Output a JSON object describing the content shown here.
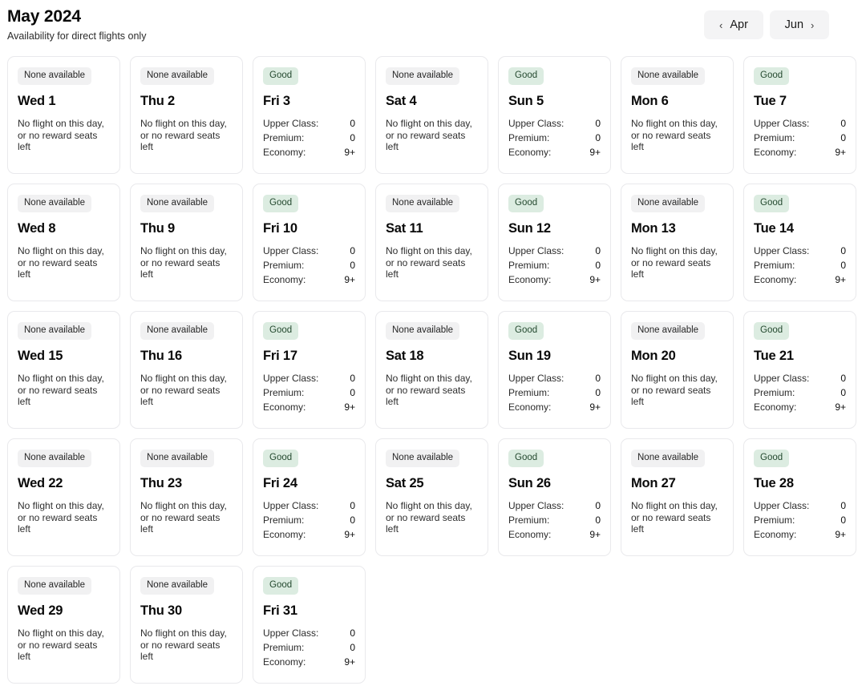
{
  "header": {
    "title": "May 2024",
    "subtitle": "Availability for direct flights only",
    "prev_label": "Apr",
    "next_label": "Jun",
    "prev_chevron": "‹",
    "next_chevron": "›"
  },
  "labels": {
    "badge_none": "None available",
    "badge_good": "Good",
    "empty_message": "No flight on this day, or no reward seats left",
    "upper_class": "Upper Class:",
    "premium": "Premium:",
    "economy": "Economy:"
  },
  "colors": {
    "good_badge_bg": "#dcece1",
    "good_badge_text": "#24492f",
    "none_badge_bg": "#f1f1f2",
    "none_badge_text": "#262626",
    "card_border": "#e9e9ec",
    "nav_button_bg": "#f4f4f5",
    "page_bg": "#ffffff"
  },
  "days": [
    {
      "day_label": "Wed 1",
      "status": "none",
      "badge": "None available",
      "message": "No flight on this day, or no reward seats left"
    },
    {
      "day_label": "Thu 2",
      "status": "none",
      "badge": "None available",
      "message": "No flight on this day, or no reward seats left"
    },
    {
      "day_label": "Fri 3",
      "status": "good",
      "badge": "Good",
      "fares": {
        "upper_class": "0",
        "premium": "0",
        "economy": "9+"
      }
    },
    {
      "day_label": "Sat 4",
      "status": "none",
      "badge": "None available",
      "message": "No flight on this day, or no reward seats left"
    },
    {
      "day_label": "Sun 5",
      "status": "good",
      "badge": "Good",
      "fares": {
        "upper_class": "0",
        "premium": "0",
        "economy": "9+"
      }
    },
    {
      "day_label": "Mon 6",
      "status": "none",
      "badge": "None available",
      "message": "No flight on this day, or no reward seats left"
    },
    {
      "day_label": "Tue 7",
      "status": "good",
      "badge": "Good",
      "fares": {
        "upper_class": "0",
        "premium": "0",
        "economy": "9+"
      }
    },
    {
      "day_label": "Wed 8",
      "status": "none",
      "badge": "None available",
      "message": "No flight on this day, or no reward seats left"
    },
    {
      "day_label": "Thu 9",
      "status": "none",
      "badge": "None available",
      "message": "No flight on this day, or no reward seats left"
    },
    {
      "day_label": "Fri 10",
      "status": "good",
      "badge": "Good",
      "fares": {
        "upper_class": "0",
        "premium": "0",
        "economy": "9+"
      }
    },
    {
      "day_label": "Sat 11",
      "status": "none",
      "badge": "None available",
      "message": "No flight on this day, or no reward seats left"
    },
    {
      "day_label": "Sun 12",
      "status": "good",
      "badge": "Good",
      "fares": {
        "upper_class": "0",
        "premium": "0",
        "economy": "9+"
      }
    },
    {
      "day_label": "Mon 13",
      "status": "none",
      "badge": "None available",
      "message": "No flight on this day, or no reward seats left"
    },
    {
      "day_label": "Tue 14",
      "status": "good",
      "badge": "Good",
      "fares": {
        "upper_class": "0",
        "premium": "0",
        "economy": "9+"
      }
    },
    {
      "day_label": "Wed 15",
      "status": "none",
      "badge": "None available",
      "message": "No flight on this day, or no reward seats left"
    },
    {
      "day_label": "Thu 16",
      "status": "none",
      "badge": "None available",
      "message": "No flight on this day, or no reward seats left"
    },
    {
      "day_label": "Fri 17",
      "status": "good",
      "badge": "Good",
      "fares": {
        "upper_class": "0",
        "premium": "0",
        "economy": "9+"
      }
    },
    {
      "day_label": "Sat 18",
      "status": "none",
      "badge": "None available",
      "message": "No flight on this day, or no reward seats left"
    },
    {
      "day_label": "Sun 19",
      "status": "good",
      "badge": "Good",
      "fares": {
        "upper_class": "0",
        "premium": "0",
        "economy": "9+"
      }
    },
    {
      "day_label": "Mon 20",
      "status": "none",
      "badge": "None available",
      "message": "No flight on this day, or no reward seats left"
    },
    {
      "day_label": "Tue 21",
      "status": "good",
      "badge": "Good",
      "fares": {
        "upper_class": "0",
        "premium": "0",
        "economy": "9+"
      }
    },
    {
      "day_label": "Wed 22",
      "status": "none",
      "badge": "None available",
      "message": "No flight on this day, or no reward seats left"
    },
    {
      "day_label": "Thu 23",
      "status": "none",
      "badge": "None available",
      "message": "No flight on this day, or no reward seats left"
    },
    {
      "day_label": "Fri 24",
      "status": "good",
      "badge": "Good",
      "fares": {
        "upper_class": "0",
        "premium": "0",
        "economy": "9+"
      }
    },
    {
      "day_label": "Sat 25",
      "status": "none",
      "badge": "None available",
      "message": "No flight on this day, or no reward seats left"
    },
    {
      "day_label": "Sun 26",
      "status": "good",
      "badge": "Good",
      "fares": {
        "upper_class": "0",
        "premium": "0",
        "economy": "9+"
      }
    },
    {
      "day_label": "Mon 27",
      "status": "none",
      "badge": "None available",
      "message": "No flight on this day, or no reward seats left"
    },
    {
      "day_label": "Tue 28",
      "status": "good",
      "badge": "Good",
      "fares": {
        "upper_class": "0",
        "premium": "0",
        "economy": "9+"
      }
    },
    {
      "day_label": "Wed 29",
      "status": "none",
      "badge": "None available",
      "message": "No flight on this day, or no reward seats left"
    },
    {
      "day_label": "Thu 30",
      "status": "none",
      "badge": "None available",
      "message": "No flight on this day, or no reward seats left"
    },
    {
      "day_label": "Fri 31",
      "status": "good",
      "badge": "Good",
      "fares": {
        "upper_class": "0",
        "premium": "0",
        "economy": "9+"
      }
    }
  ]
}
